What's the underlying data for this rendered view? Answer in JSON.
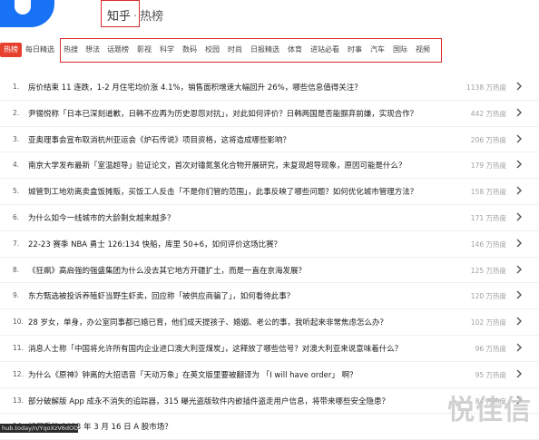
{
  "header": {
    "brand": "知乎",
    "separator": "·",
    "subtitle": "热榜"
  },
  "tabs": [
    {
      "label": "热榜",
      "active": true
    },
    {
      "label": "每日精选"
    },
    {
      "label": "热搜"
    },
    {
      "label": "想法"
    },
    {
      "label": "话题榜"
    },
    {
      "label": "影视"
    },
    {
      "label": "科学"
    },
    {
      "label": "数码"
    },
    {
      "label": "校园"
    },
    {
      "label": "时尚"
    },
    {
      "label": "日报精选"
    },
    {
      "label": "体育"
    },
    {
      "label": "进站必看"
    },
    {
      "label": "时事"
    },
    {
      "label": "汽车"
    },
    {
      "label": "国际"
    },
    {
      "label": "视频"
    }
  ],
  "items": [
    {
      "rank": "1.",
      "title": "房价结束 11 连跌，1-2 月住宅均价涨 4.1%，销售面积增速大幅回升 26%，哪些信息值得关注？",
      "heat": "1138 万热度"
    },
    {
      "rank": "2.",
      "title": "尹锡悦称「日本已深刻道歉，日韩不应再为历史恩怨对抗」，对此如何评价？日韩两国是否能摒弃前嫌，实现合作？",
      "heat": "442 万热度"
    },
    {
      "rank": "3.",
      "title": "亚奥理事会宣布取消杭州亚运会《炉石传说》项目资格，这将造成哪些影响？",
      "heat": "206 万热度"
    },
    {
      "rank": "4.",
      "title": "南京大学发布最新「室温超导」验证论文，首次对镥氮氢化合物开展研究，未复现超导现象，原因可能是什么？",
      "heat": "179 万热度"
    },
    {
      "rank": "5.",
      "title": "城管到工地劝离卖盒饭摊贩，买饭工人反击「不是你们管的范围」，此事反映了哪些问题？如何优化城市管理方法？",
      "heat": "158 万热度"
    },
    {
      "rank": "6.",
      "title": "为什么如今一线城市的大龄剩女越来越多？",
      "heat": "171 万热度"
    },
    {
      "rank": "7.",
      "title": "22-23 赛季 NBA 勇士 126:134 快船，库里 50+6，如何评价这场比赛？",
      "heat": "146 万热度"
    },
    {
      "rank": "8.",
      "title": "《狂飙》高启强的强盛集团为什么没去其它地方开疆扩土，而是一直在京海发展？",
      "heat": "125 万热度"
    },
    {
      "rank": "9.",
      "title": "东方甄选被投诉养殖虾当野生虾卖，回应称「被供应商骗了」，如何看待此事？",
      "heat": "120 万热度"
    },
    {
      "rank": "10.",
      "title": "28 岁女，单身，办公室同事都已婚已育，他们成天提孩子、婚姻、老公的事，我听起来非常焦虑怎么办？",
      "heat": "102 万热度"
    },
    {
      "rank": "11.",
      "title": "消息人士称「中国将允许所有国内企业进口澳大利亚煤炭」，这释放了哪些信号？对澳大利亚来说意味着什么？",
      "heat": "96 万热度"
    },
    {
      "rank": "12.",
      "title": "为什么《原神》钟离的大招语音「天动万象」在英文版里要被翻译为 「I will have order」 啊？",
      "heat": "95 万热度"
    },
    {
      "rank": "13.",
      "title": "部分破解版 App 成永不消失的追踪器，315 曝光盗版软件内嵌插件盗走用户信息，将带来哪些安全隐患？",
      "heat": "84 万热度"
    },
    {
      "rank": "14.",
      "title": "如何看待 2023 年 3 月 16 日 A 股市场？",
      "heat": ""
    }
  ],
  "statusbar": {
    "url": "hub.today/n/YqoXzV6dOD"
  },
  "watermark": "悦佳信",
  "colors": {
    "accent": "#e5412c",
    "brand_blue": "#1772f6",
    "annotation_red": "#d92c2c"
  }
}
